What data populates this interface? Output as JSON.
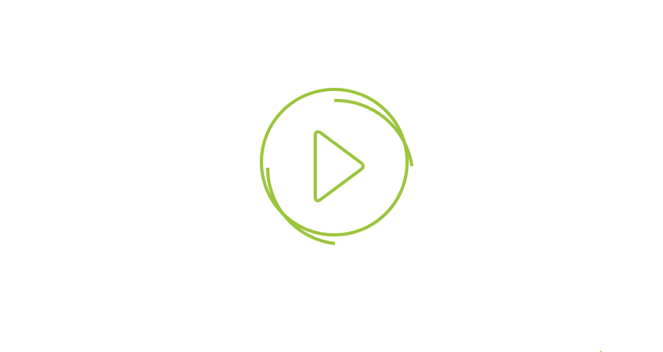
{
  "player": {
    "accent_color": "#9bc53d",
    "icon": "play-icon",
    "control": "play-button",
    "decorations": [
      "outer-arc-top-right",
      "outer-arc-bottom-left"
    ]
  },
  "pointer": {
    "icon": "mouse-pointer-icon",
    "color": "#9bc53d"
  }
}
